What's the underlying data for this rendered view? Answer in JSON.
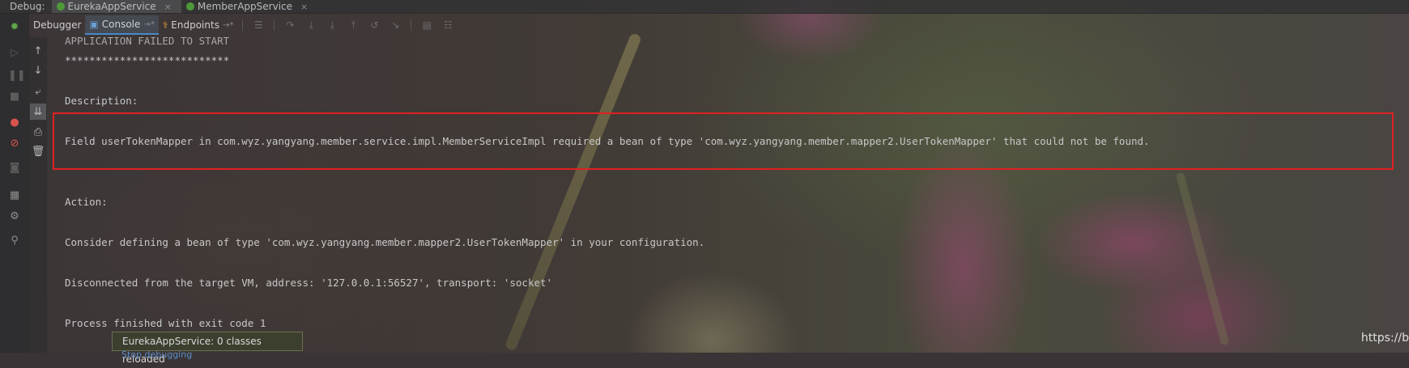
{
  "debug_bar": {
    "label": "Debug:",
    "tabs": [
      {
        "label": "EurekaAppService",
        "icon": "spring-boot-icon"
      },
      {
        "label": "MemberAppService",
        "icon": "spring-boot-icon"
      }
    ],
    "close_glyph": "×"
  },
  "tool_tabs": {
    "debugger": "Debugger",
    "console": "Console",
    "endpoints": "Endpoints",
    "pin_glyph": "→*"
  },
  "console": {
    "lines": [
      "APPLICATION FAILED TO START",
      "***************************",
      "Description:",
      "Field userTokenMapper in com.wyz.yangyang.member.service.impl.MemberServiceImpl required a bean of type 'com.wyz.yangyang.member.mapper2.UserTokenMapper' that could not be found.",
      "Action:",
      "Consider defining a bean of type 'com.wyz.yangyang.member.mapper2.UserTokenMapper' in your configuration.",
      "Disconnected from the target VM, address: '127.0.0.1:56527', transport: 'socket'",
      "Process finished with exit code 1"
    ]
  },
  "toast": {
    "message": "EurekaAppService: 0 classes reloaded",
    "sub": "Stop debugging"
  },
  "watermark": "https://b",
  "colors": {
    "highlight": "#e02020",
    "active_tab_underline": "#4a88c7",
    "console_text": "#c8c8c8"
  }
}
